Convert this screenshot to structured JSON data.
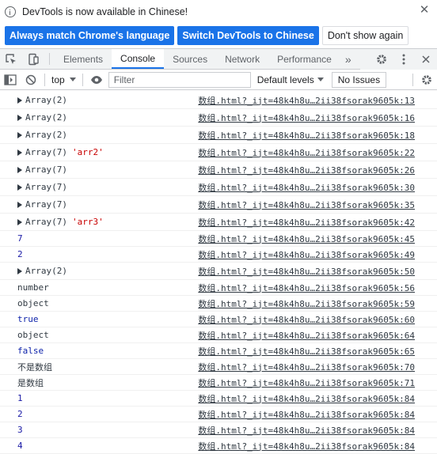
{
  "infobar": {
    "message": "DevTools is now available in Chinese!",
    "buttons": [
      {
        "label": "Always match Chrome's language"
      },
      {
        "label": "Switch DevTools to Chinese"
      },
      {
        "label": "Don't show again"
      }
    ]
  },
  "tabs": {
    "items": [
      "Elements",
      "Console",
      "Sources",
      "Network",
      "Performance"
    ],
    "active": "Console",
    "more": "»"
  },
  "console_toolbar": {
    "context": "top",
    "filter_placeholder": "Filter",
    "levels": "Default levels",
    "issues": "No Issues"
  },
  "console": {
    "accent": "#1a73e8",
    "rows": [
      {
        "kind": "expandable",
        "text": "Array(2)",
        "label": "",
        "source": "数组.html?_ijt=48k4h8u…2ii38fsorak9605k:13"
      },
      {
        "kind": "expandable",
        "text": "Array(2)",
        "label": "",
        "source": "数组.html?_ijt=48k4h8u…2ii38fsorak9605k:16"
      },
      {
        "kind": "expandable",
        "text": "Array(2)",
        "label": "",
        "source": "数组.html?_ijt=48k4h8u…2ii38fsorak9605k:18"
      },
      {
        "kind": "expandable",
        "text": "Array(7)",
        "label": "'arr2'",
        "source": "数组.html?_ijt=48k4h8u…2ii38fsorak9605k:22"
      },
      {
        "kind": "expandable",
        "text": "Array(7)",
        "label": "",
        "source": "数组.html?_ijt=48k4h8u…2ii38fsorak9605k:26"
      },
      {
        "kind": "expandable",
        "text": "Array(7)",
        "label": "",
        "source": "数组.html?_ijt=48k4h8u…2ii38fsorak9605k:30"
      },
      {
        "kind": "expandable",
        "text": "Array(7)",
        "label": "",
        "source": "数组.html?_ijt=48k4h8u…2ii38fsorak9605k:35"
      },
      {
        "kind": "expandable",
        "text": "Array(7)",
        "label": "'arr3'",
        "source": "数组.html?_ijt=48k4h8u…2ii38fsorak9605k:42"
      },
      {
        "kind": "num",
        "text": "7",
        "label": "",
        "source": "数组.html?_ijt=48k4h8u…2ii38fsorak9605k:45"
      },
      {
        "kind": "num",
        "text": "2",
        "label": "",
        "source": "数组.html?_ijt=48k4h8u…2ii38fsorak9605k:49"
      },
      {
        "kind": "expandable",
        "text": "Array(2)",
        "label": "",
        "source": "数组.html?_ijt=48k4h8u…2ii38fsorak9605k:50"
      },
      {
        "kind": "plain",
        "text": "number",
        "label": "",
        "source": "数组.html?_ijt=48k4h8u…2ii38fsorak9605k:56"
      },
      {
        "kind": "plain",
        "text": "object",
        "label": "",
        "source": "数组.html?_ijt=48k4h8u…2ii38fsorak9605k:59"
      },
      {
        "kind": "kw",
        "text": "true",
        "label": "",
        "source": "数组.html?_ijt=48k4h8u…2ii38fsorak9605k:60"
      },
      {
        "kind": "plain",
        "text": "object",
        "label": "",
        "source": "数组.html?_ijt=48k4h8u…2ii38fsorak9605k:64"
      },
      {
        "kind": "kw",
        "text": "false",
        "label": "",
        "source": "数组.html?_ijt=48k4h8u…2ii38fsorak9605k:65"
      },
      {
        "kind": "cjk",
        "text": "不是数组",
        "label": "",
        "source": "数组.html?_ijt=48k4h8u…2ii38fsorak9605k:70"
      },
      {
        "kind": "cjk",
        "text": "是数组",
        "label": "",
        "source": "数组.html?_ijt=48k4h8u…2ii38fsorak9605k:71"
      },
      {
        "kind": "num",
        "text": "1",
        "label": "",
        "source": "数组.html?_ijt=48k4h8u…2ii38fsorak9605k:84"
      },
      {
        "kind": "num",
        "text": "2",
        "label": "",
        "source": "数组.html?_ijt=48k4h8u…2ii38fsorak9605k:84"
      },
      {
        "kind": "num",
        "text": "3",
        "label": "",
        "source": "数组.html?_ijt=48k4h8u…2ii38fsorak9605k:84"
      },
      {
        "kind": "num",
        "text": "4",
        "label": "",
        "source": "数组.html?_ijt=48k4h8u…2ii38fsorak9605k:84"
      }
    ]
  }
}
